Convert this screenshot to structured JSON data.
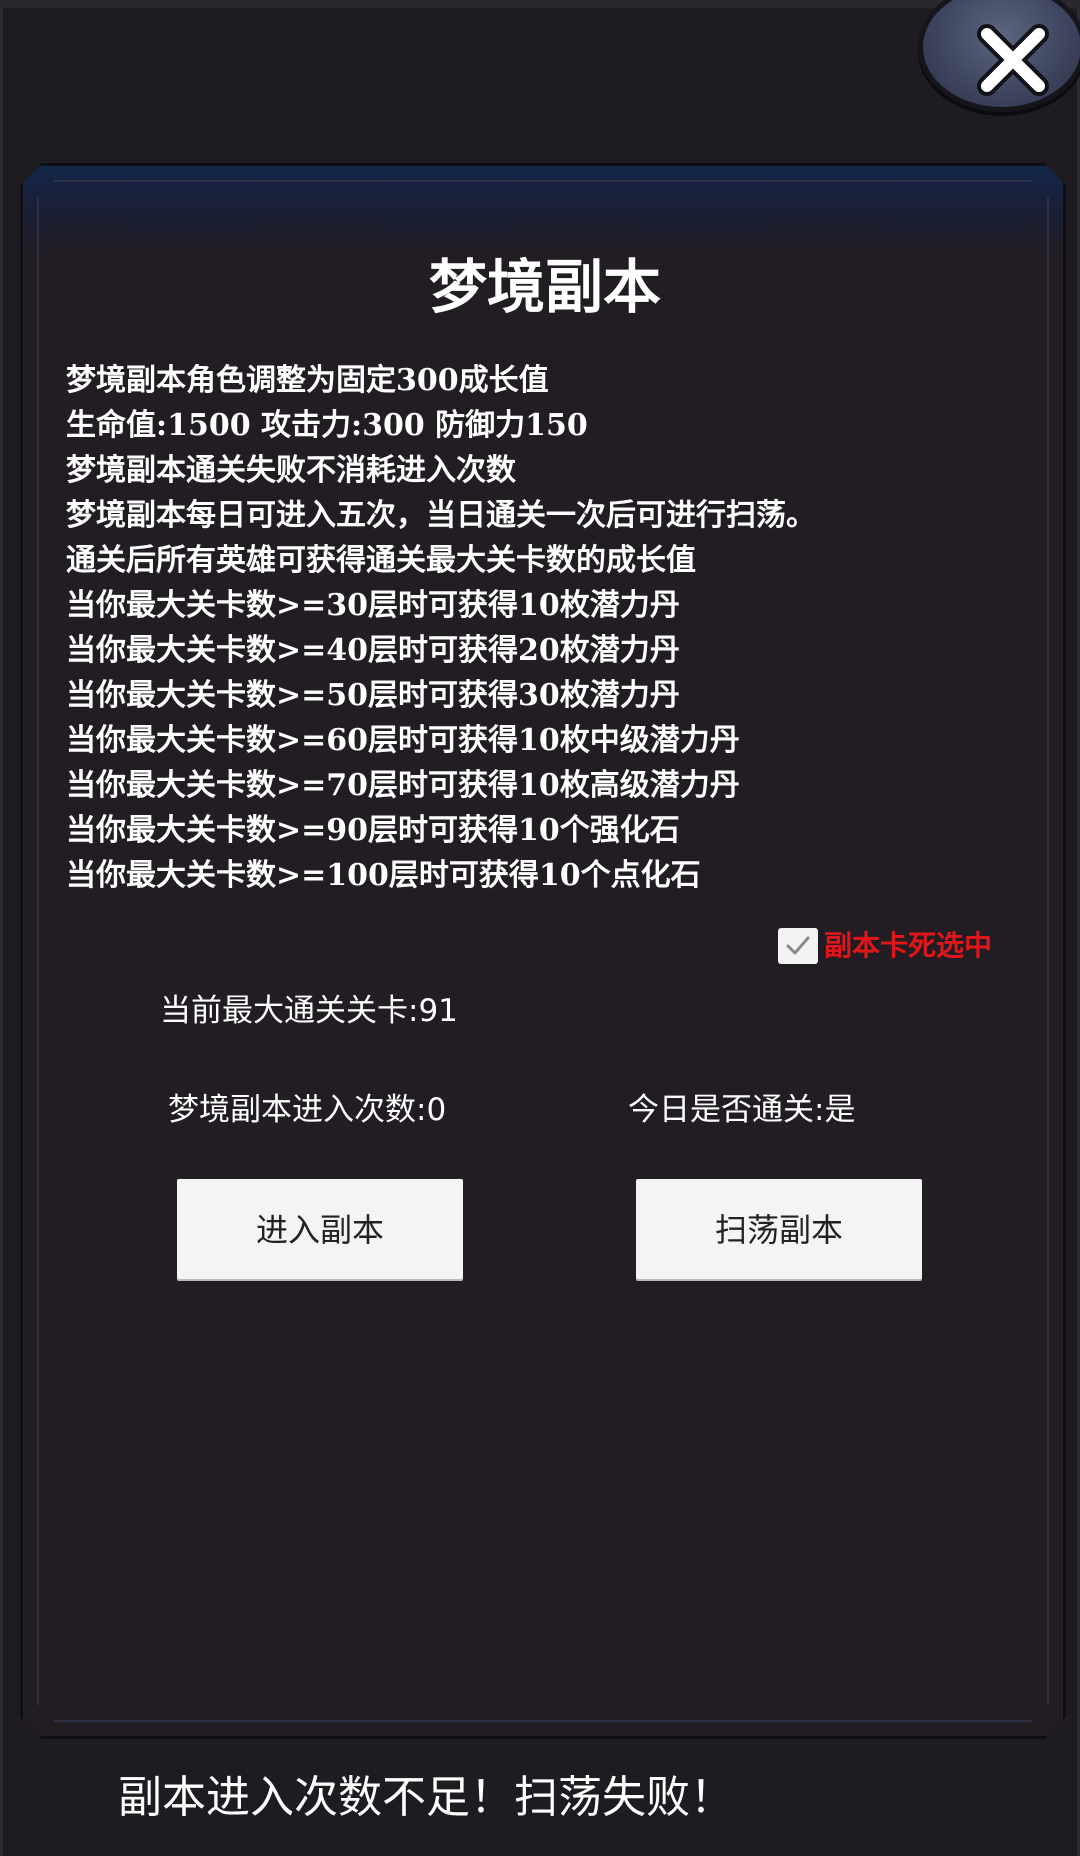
{
  "dialog": {
    "title": "梦境副本",
    "rules": [
      "梦境副本角色调整为固定300成长值",
      "生命值:1500 攻击力:300 防御力150",
      "梦境副本通关失败不消耗进入次数",
      "梦境副本每日可进入五次，当日通关一次后可进行扫荡。",
      "通关后所有英雄可获得通关最大关卡数的成长值",
      "当你最大关卡数>=30层时可获得10枚潜力丹",
      "当你最大关卡数>=40层时可获得20枚潜力丹",
      "当你最大关卡数>=50层时可获得30枚潜力丹",
      "当你最大关卡数>=60层时可获得10枚中级潜力丹",
      "当你最大关卡数>=70层时可获得10枚高级潜力丹",
      "当你最大关卡数>=90层时可获得10个强化石",
      "当你最大关卡数>=100层时可获得10个点化石"
    ],
    "checkbox": {
      "label": "副本卡死选中",
      "checked": true
    },
    "max_cleared_level": "当前最大通关关卡:91",
    "enter_count": "梦境副本进入次数:0",
    "cleared_today": "今日是否通关:是",
    "enter_button_label": "进入副本",
    "sweep_button_label": "扫荡副本"
  },
  "toast": {
    "message": "副本进入次数不足！扫荡失败！"
  },
  "icons": {
    "close": "close-icon",
    "checkbox": "checkmark-icon"
  },
  "colors": {
    "background": "#1e1b21",
    "panel_header": "#142649",
    "checkbox_label": "#e0161a",
    "button_bg": "#f4f4f4",
    "close_button": "#4a5270"
  }
}
